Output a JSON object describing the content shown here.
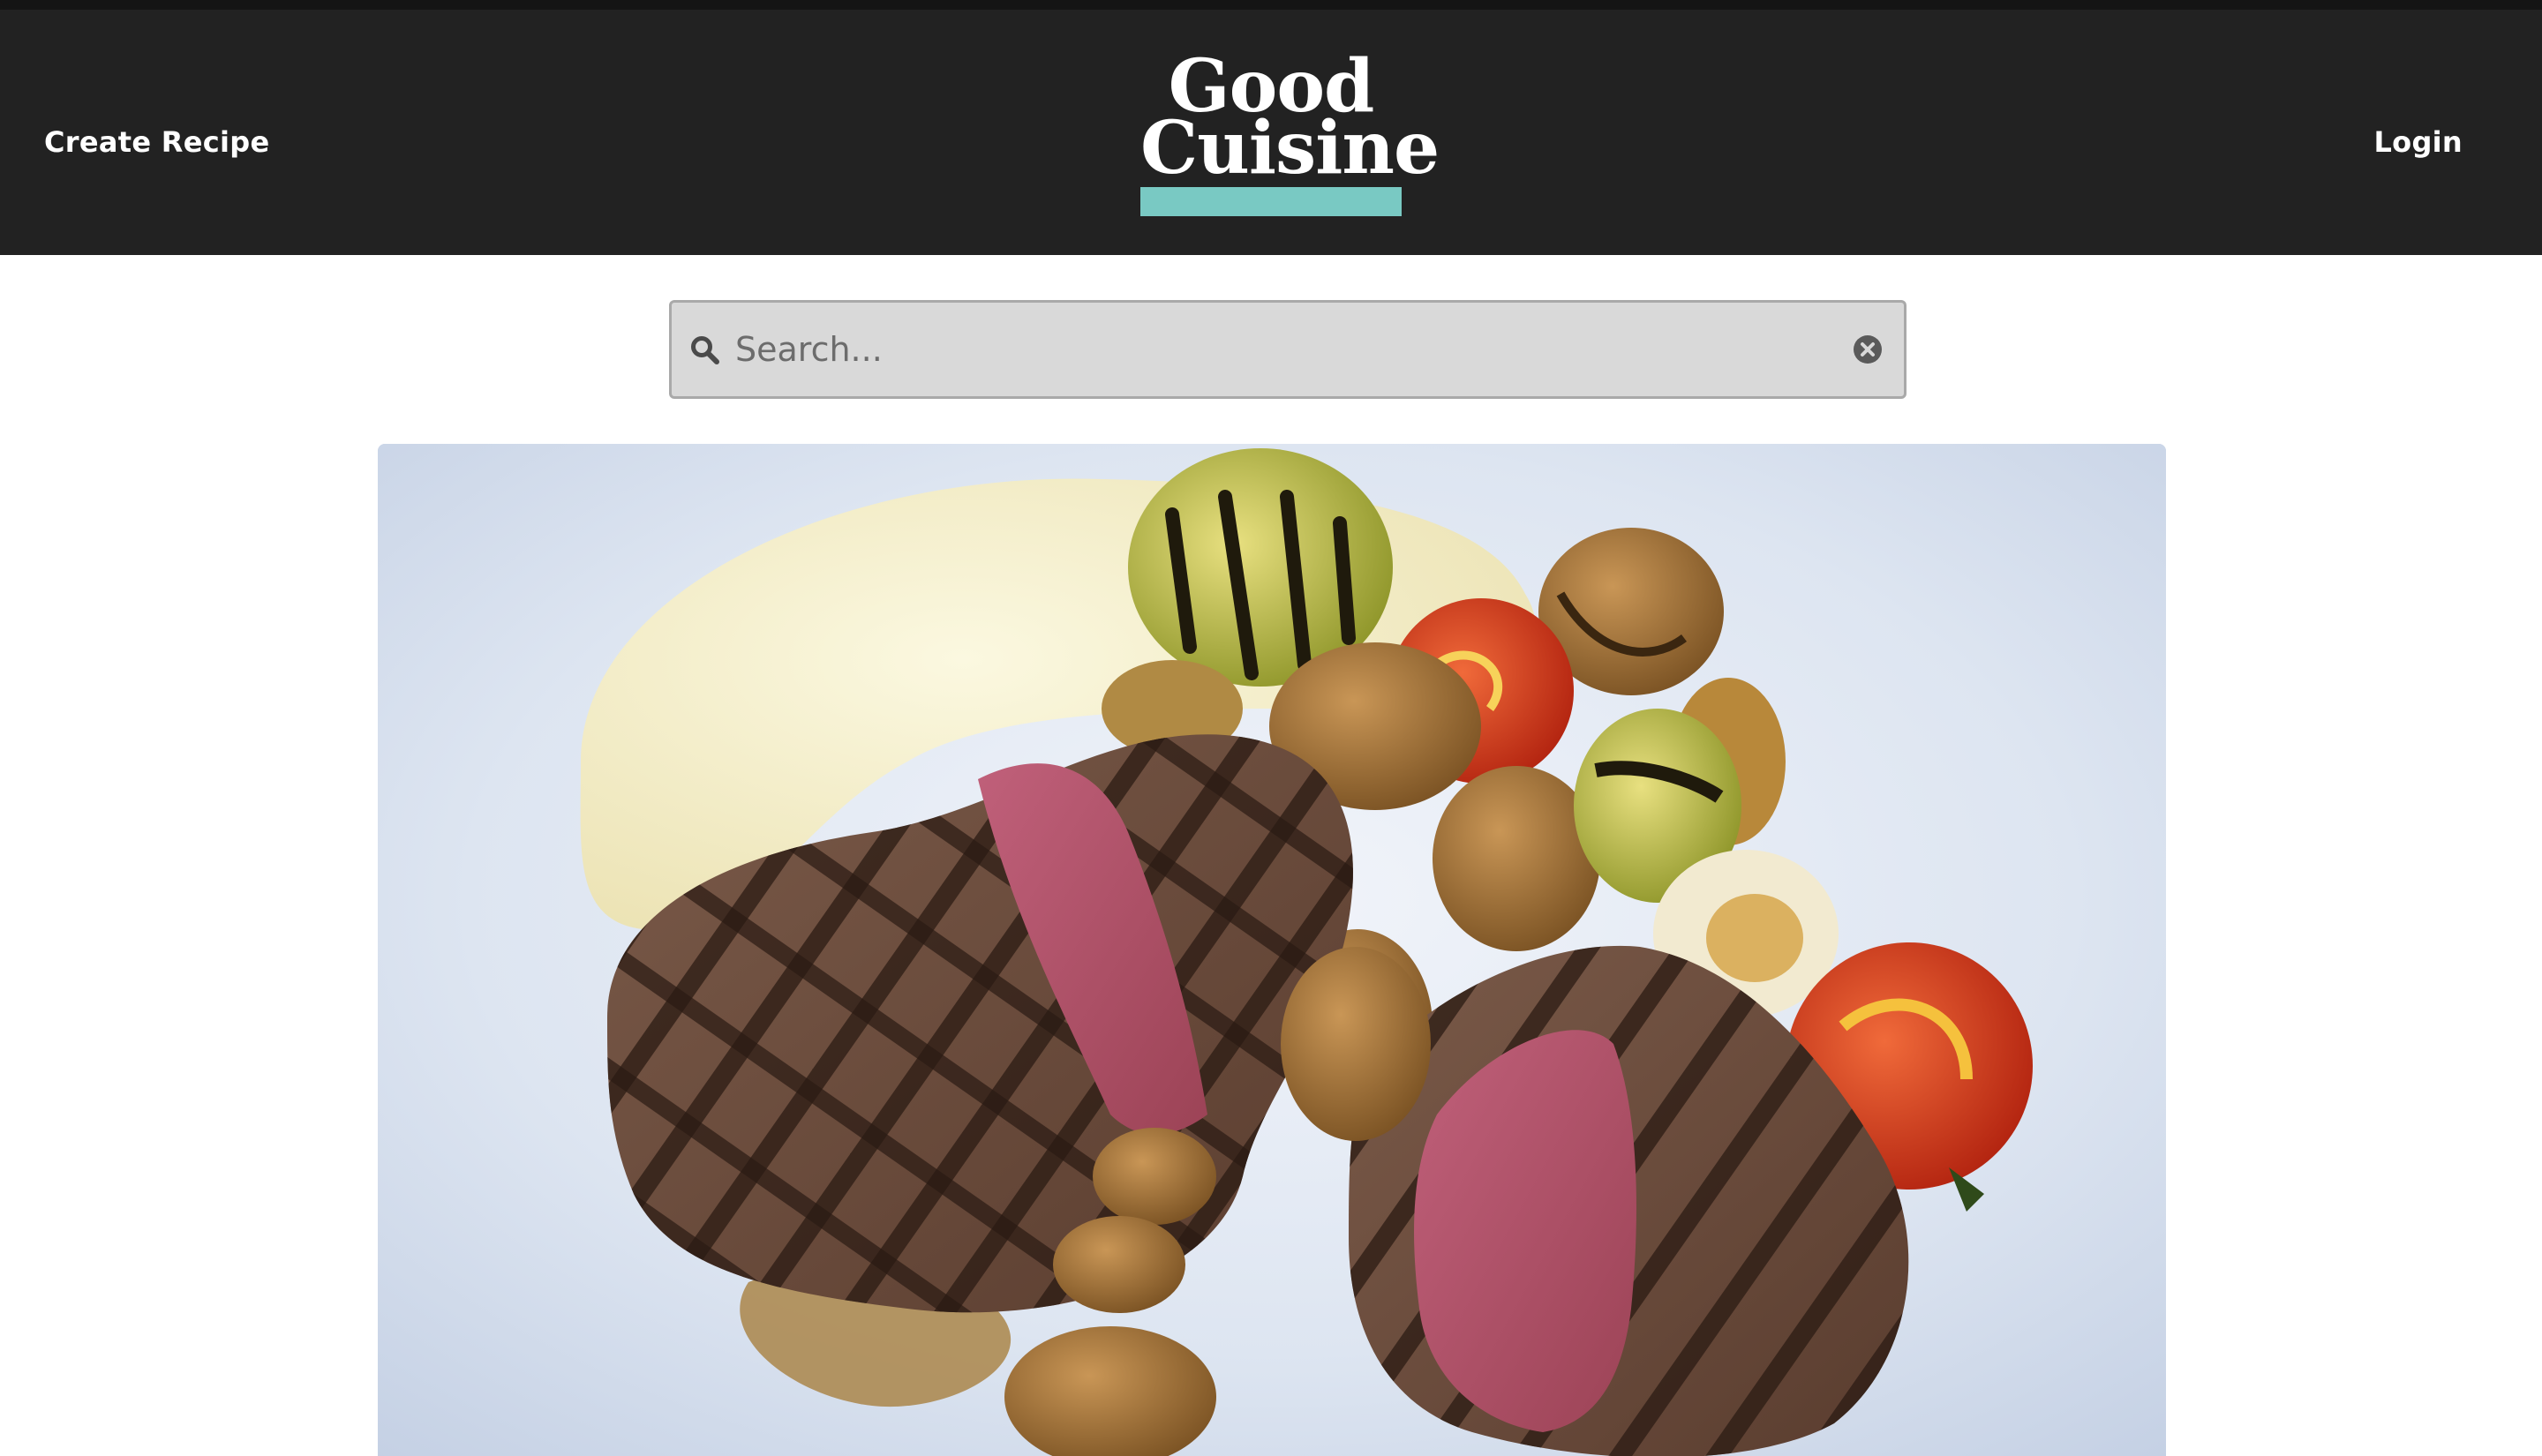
{
  "header": {
    "left_link": "Create Recipe",
    "right_link": "Login",
    "logo": {
      "line1": "Good",
      "line2": "Cuisine",
      "accent_color": "#79c9c3"
    }
  },
  "search": {
    "placeholder": "Search...",
    "value": "",
    "icon": "search-icon",
    "clear_icon": "clear-circle-icon"
  },
  "hero": {
    "subject": "grilled steak with mashed potatoes, brussels sprouts, mushrooms and tomatoes"
  },
  "colors": {
    "header_bg": "#222222",
    "page_bg": "#ffffff",
    "search_bg": "#d9d9d9",
    "accent": "#79c9c3"
  }
}
